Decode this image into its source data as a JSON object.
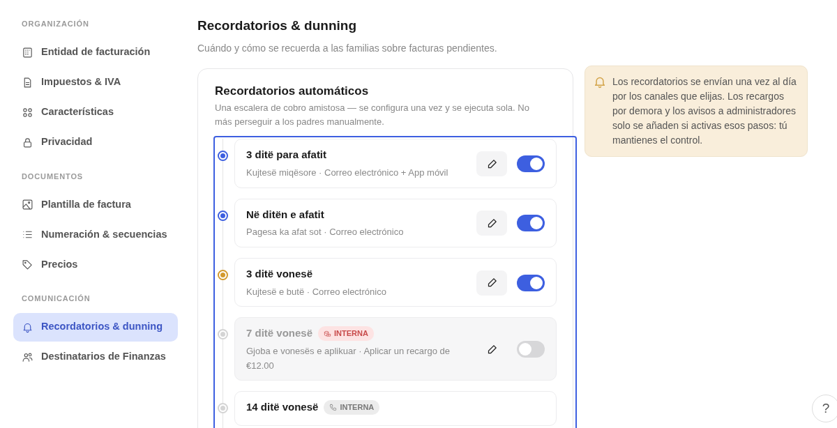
{
  "sidebar": {
    "sections": [
      {
        "heading": "ORGANIZACIÓN",
        "items": [
          {
            "label": "Entidad de facturación",
            "selected": false
          },
          {
            "label": "Impuestos & IVA",
            "selected": false
          },
          {
            "label": "Características",
            "selected": false
          },
          {
            "label": "Privacidad",
            "selected": false
          }
        ]
      },
      {
        "heading": "DOCUMENTOS",
        "items": [
          {
            "label": "Plantilla de factura",
            "selected": false
          },
          {
            "label": "Numeración & secuencias",
            "selected": false
          },
          {
            "label": "Precios",
            "selected": false
          }
        ]
      },
      {
        "heading": "COMUNICACIÓN",
        "items": [
          {
            "label": "Recordatorios & dunning",
            "selected": true
          },
          {
            "label": "Destinatarios de Finanzas",
            "selected": false
          }
        ]
      }
    ]
  },
  "page": {
    "title": "Recordatorios & dunning",
    "subtitle": "Cuándo y cómo se recuerda a las familias sobre facturas pendientes."
  },
  "card": {
    "title": "Recordatorios automáticos",
    "description": "Una escalera de cobro amistosa — se configura una vez y se ejecuta sola. No más perseguir a los padres manualmente.",
    "steps": [
      {
        "title": "3 ditë para afatit",
        "detail": "Kujtesë miqësore · Correo electrónico + App móvil",
        "color": "#3d5fe0",
        "on": true
      },
      {
        "title": "Në ditën e afatit",
        "detail": "Pagesa ka afat sot · Correo electrónico",
        "color": "#3d5fe0",
        "on": true
      },
      {
        "title": "3 ditë vonesë",
        "detail": "Kujtesë e butë · Correo electrónico",
        "color": "#d39a2e",
        "on": true
      },
      {
        "title": "7 ditë vonesë",
        "badge": {
          "label": "INTERNA",
          "kind": "fee"
        },
        "detail": "Gjoba e vonesës e aplikuar · Aplicar un recargo de €12.00",
        "color": "#d4d4d4",
        "on": false
      },
      {
        "title": "14 ditë vonesë",
        "badge": {
          "label": "INTERNA",
          "kind": "call"
        },
        "color": "#d4d4d4"
      }
    ]
  },
  "info": {
    "text": "Los recordatorios se envían una vez al día por los canales que elijas. Los recargos por demora y los avisos a administradores solo se añaden si activas esos pasos: tú mantienes el control."
  },
  "help": {
    "label": "?"
  }
}
